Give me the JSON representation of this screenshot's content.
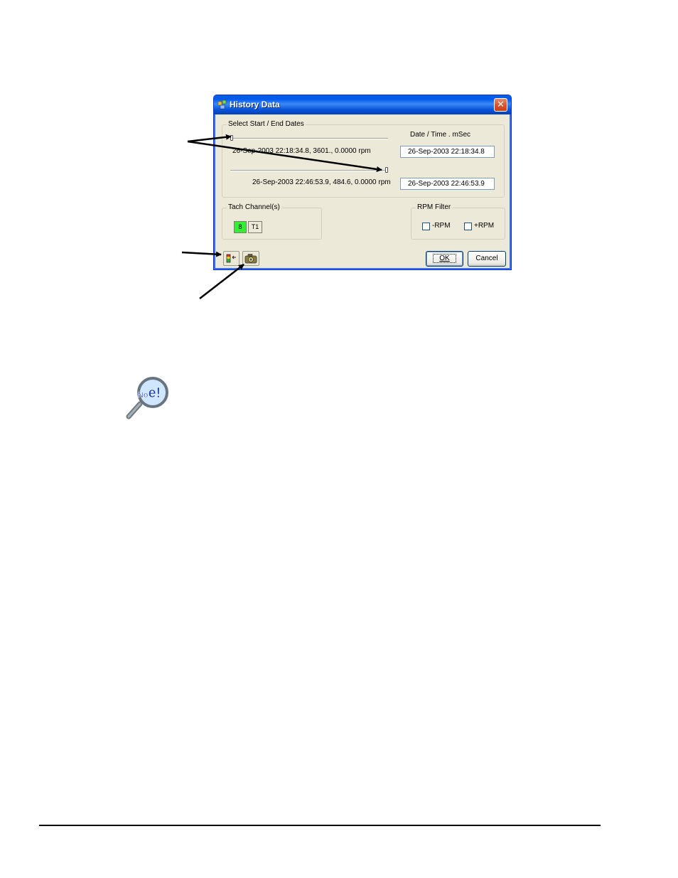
{
  "dialog": {
    "title": "History Data",
    "close_symbol": "✕",
    "dates_group_label": "Select Start / End Dates",
    "date_column_header": "Date / Time . mSec",
    "start_slider_readout": "26-Sep-2003 22:18:34.8, 3601., 0.0000 rpm",
    "end_slider_readout": "26-Sep-2003 22:46:53.9, 484.6, 0.0000 rpm",
    "start_date_value": "26-Sep-2003 22:18:34.8",
    "end_date_value": "26-Sep-2003 22:46:53.9",
    "start_slider_position": 0.0,
    "end_slider_position": 1.0,
    "tach_group_label": "Tach Channel(s)",
    "tach_channels": [
      {
        "label": "8",
        "color": "#33ee33"
      },
      {
        "label": "T1",
        "color": "#ece9d8"
      }
    ],
    "rpm_group_label": "RPM Filter",
    "rpm_minus_label": "-RPM",
    "rpm_plus_label": "+RPM",
    "rpm_minus_checked": false,
    "rpm_plus_checked": false,
    "ok_label": "OK",
    "cancel_label": "Cancel"
  },
  "icons": {
    "title": "history-data-icon",
    "toolbar_left": "range-selector-icon",
    "toolbar_right": "snapshot-camera-icon",
    "note": "note-magnifier-icon"
  },
  "note_icon_text": "Note!",
  "colors": {
    "titlebar": "#0a5fe0",
    "dialog_bg": "#ece9d8",
    "tach_active": "#33ee33",
    "close_button": "#d8532c"
  }
}
